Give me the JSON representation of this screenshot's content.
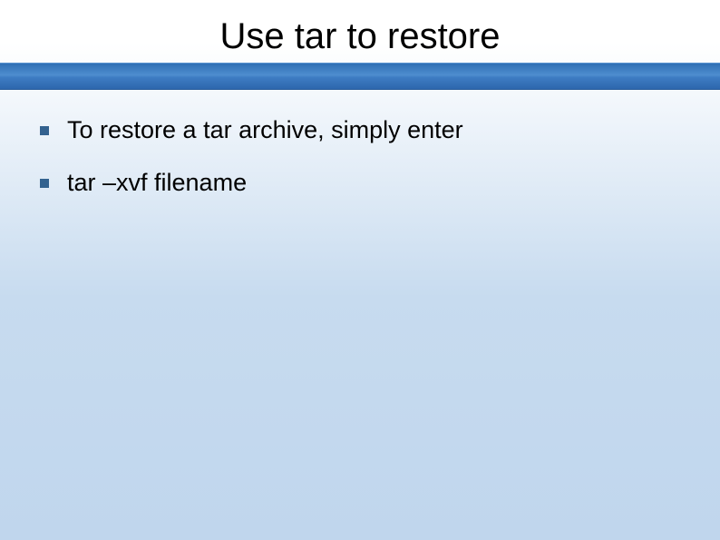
{
  "slide": {
    "title": "Use tar to restore",
    "bullets": [
      "To restore a tar archive, simply enter",
      "tar –xvf filename"
    ]
  }
}
